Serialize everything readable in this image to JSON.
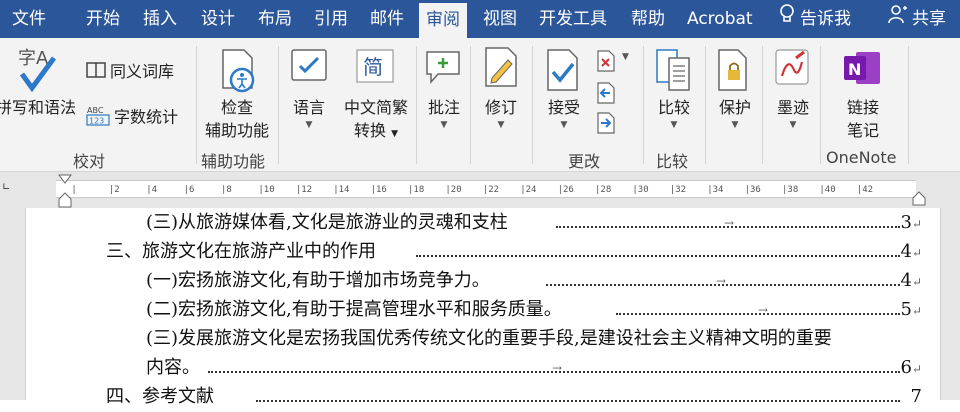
{
  "tabs": [
    {
      "label": "文件",
      "active": false
    },
    {
      "label": "开始",
      "active": false
    },
    {
      "label": "插入",
      "active": false
    },
    {
      "label": "设计",
      "active": false
    },
    {
      "label": "布局",
      "active": false
    },
    {
      "label": "引用",
      "active": false
    },
    {
      "label": "邮件",
      "active": false
    },
    {
      "label": "审阅",
      "active": true
    },
    {
      "label": "视图",
      "active": false
    },
    {
      "label": "开发工具",
      "active": false
    },
    {
      "label": "帮助",
      "active": false
    },
    {
      "label": "Acrobat",
      "active": false
    }
  ],
  "tell_me": "告诉我",
  "share": "共享",
  "ribbon": {
    "groups": {
      "proofing": "校对",
      "accessibility": "辅助功能",
      "changes": "更改",
      "compare": "比较",
      "onenote": "OneNote"
    },
    "spelling": "拼写和语法",
    "thesaurus": "同义词库",
    "word_count": "字数统计",
    "check_acc_1": "检查",
    "check_acc_2": "辅助功能",
    "language": "语言",
    "convert_1": "中文简繁",
    "convert_2": "转换",
    "comments": "批注",
    "tracking": "修订",
    "accept": "接受",
    "compare_btn": "比较",
    "protect": "保护",
    "ink": "墨迹",
    "linked_1": "链接",
    "linked_2": "笔记"
  },
  "ruler_ticks": [
    "2",
    "",
    "2",
    "4",
    "6",
    "8",
    "10",
    "12",
    "14",
    "16",
    "18",
    "20",
    "22",
    "24",
    "26",
    "28",
    "30",
    "32",
    "34",
    "36",
    "38",
    "40",
    "42"
  ],
  "toc": [
    {
      "text": "(三)从旅游媒体看,文化是旅游业的灵魂和支柱",
      "page": "3"
    },
    {
      "text": "三、旅游文化在旅游产业中的作用",
      "page": "4"
    },
    {
      "text": "(一)宏扬旅游文化,有助于增加市场竞争力。",
      "page": "4"
    },
    {
      "text": "(二)宏扬旅游文化,有助于提高管理水平和服务质量。",
      "page": "5"
    },
    {
      "text": "(三)发展旅游文化是宏扬我国优秀传统文化的重要手段,是建设社会主义精神文明的重要",
      "page": ""
    },
    {
      "text": "内容。",
      "page": "6"
    },
    {
      "text": "四、参考文献",
      "page": "7"
    }
  ],
  "colors": {
    "accent": "#2b579a",
    "ribbon_bg": "#f3f3f3",
    "onenote": "#7719aa"
  }
}
